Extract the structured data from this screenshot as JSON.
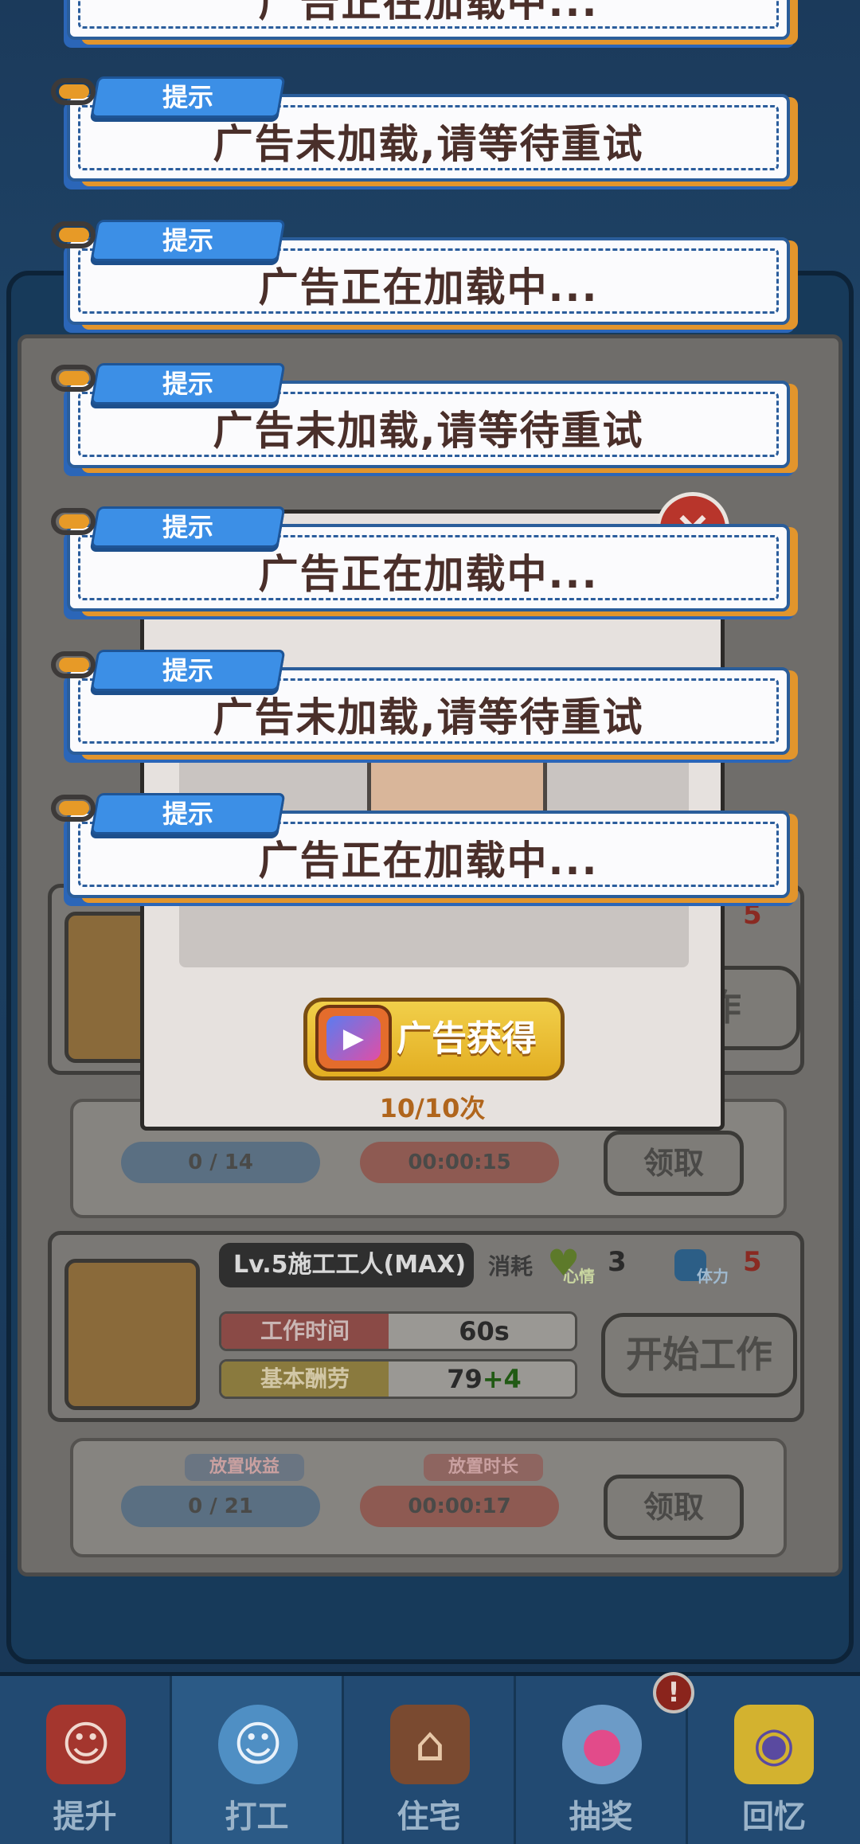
{
  "toasts": [
    {
      "tag": "提示",
      "text": "广告正在加载中..."
    },
    {
      "tag": "提示",
      "text": "广告未加载,请等待重试"
    },
    {
      "tag": "提示",
      "text": "广告正在加载中..."
    },
    {
      "tag": "提示",
      "text": "广告未加载,请等待重试"
    },
    {
      "tag": "提示",
      "text": "广告正在加载中..."
    },
    {
      "tag": "提示",
      "text": "广告未加载,请等待重试"
    },
    {
      "tag": "提示",
      "text": "广告正在加载中..."
    }
  ],
  "modal": {
    "ad_button_label": "广告获得",
    "ad_count": "10/10次",
    "close_label": "×"
  },
  "background_jobs": {
    "job1": {
      "stamina": "5",
      "start_label": "工作",
      "idle_income": "0 / 14",
      "idle_time": "00:00:15",
      "collect_label": "领取"
    },
    "job2": {
      "title": "Lv.5施工工人(MAX)",
      "consume_label": "消耗",
      "mood_label": "心情",
      "mood_value": "3",
      "stamina_label": "体力",
      "stamina_value": "5",
      "work_time_label": "工作时间",
      "work_time_value": "60s",
      "pay_label": "基本酬劳",
      "pay_base": "79",
      "pay_bonus": "+4",
      "start_label": "开始工作",
      "idle_income_tag": "放置收益",
      "idle_income": "0 / 21",
      "idle_time_tag": "放置时长",
      "idle_time": "00:00:17",
      "collect_label": "领取"
    }
  },
  "bottom_nav": [
    {
      "label": "提升"
    },
    {
      "label": "打工"
    },
    {
      "label": "住宅"
    },
    {
      "label": "抽奖"
    },
    {
      "label": "回忆"
    }
  ],
  "nav_badge": "!",
  "colors": {
    "toast_border": "#2a5d9a",
    "toast_tag": "#3c8fe6",
    "toast_edge": "#e2952c",
    "ad_button": "#f1cf4a",
    "close": "#b8352b"
  }
}
